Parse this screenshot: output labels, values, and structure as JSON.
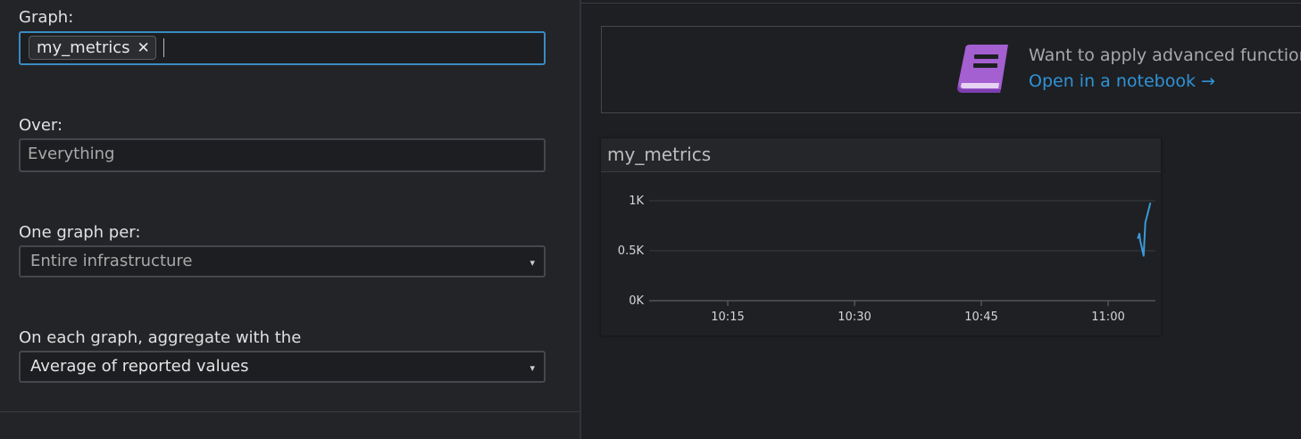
{
  "query": {
    "graph_label": "Graph:",
    "graph_tag": "my_metrics",
    "over_label": "Over:",
    "over_placeholder": "Everything",
    "one_graph_per_label": "One graph per:",
    "one_graph_per_value": "Entire infrastructure",
    "aggregate_label": "On each graph, aggregate with the",
    "aggregate_value": "Average of reported values",
    "remove_symbol": "✕",
    "dropdown_symbol": "▾"
  },
  "notebook": {
    "prompt": "Want to apply advanced functions",
    "link": "Open in a notebook →",
    "icon": "notebook-icon",
    "icon_color": "#a45fd0"
  },
  "chart_data": {
    "type": "line",
    "title": "my_metrics",
    "y_ticks": [
      "1K",
      "0.5K",
      "0K"
    ],
    "x_ticks": [
      "10:15",
      "10:30",
      "10:45",
      "11:00"
    ],
    "ylim": [
      0,
      1000
    ],
    "grid": true,
    "series": [
      {
        "color": "#3a9ad9",
        "points": [
          {
            "x": "11:03.5",
            "y": 620
          },
          {
            "x": "11:03.7",
            "y": 670
          },
          {
            "x": "11:03.8",
            "y": 600
          },
          {
            "x": "11:04.2",
            "y": 450
          },
          {
            "x": "11:04.4",
            "y": 780
          },
          {
            "x": "11:04.7",
            "y": 880
          },
          {
            "x": "11:05.0",
            "y": 980
          }
        ]
      }
    ]
  }
}
